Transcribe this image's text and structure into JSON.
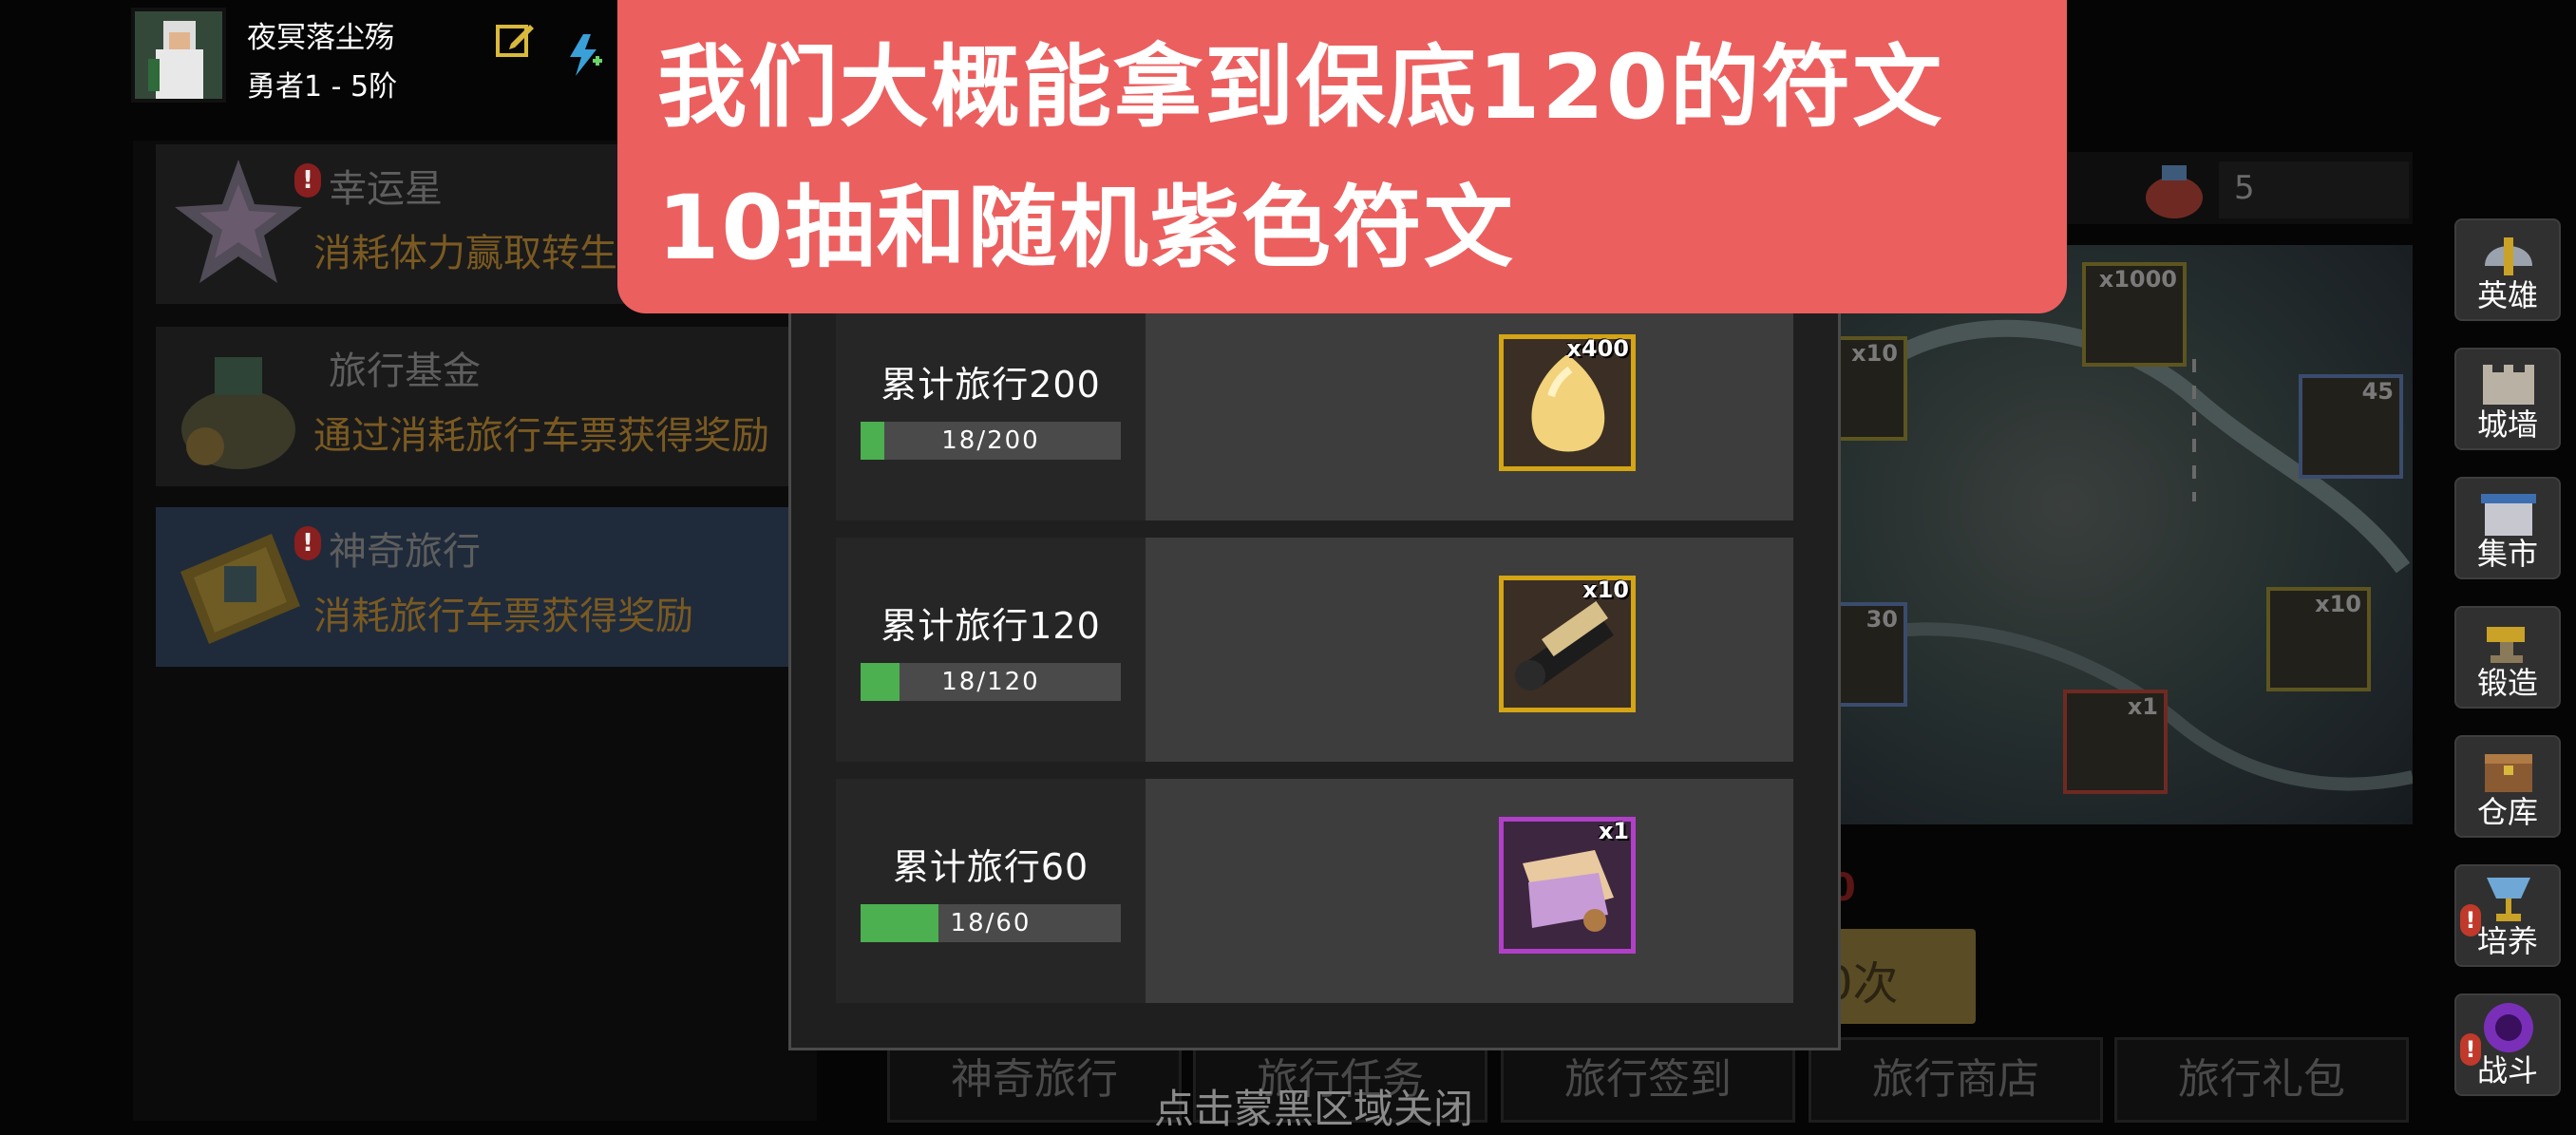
{
  "player": {
    "name": "夜冥落尘殇",
    "rank": "勇者1 - 5阶",
    "edit_icon": "edit-icon",
    "boost_icon": "lightning-plus-icon"
  },
  "events": [
    {
      "title": "幸运星",
      "desc": "消耗体力赢取转生",
      "icon": "star-crystal-icon",
      "alert": "!"
    },
    {
      "title": "旅行基金",
      "desc": "通过消耗旅行车票获得奖励",
      "icon": "money-bag-icon",
      "alert": ""
    },
    {
      "title": "神奇旅行",
      "desc": "消耗旅行车票获得奖励",
      "icon": "ticket-icon",
      "alert": "!"
    }
  ],
  "map": {
    "ticket_count": "5",
    "items": [
      {
        "count": "x1000",
        "icon": "bone-icon"
      },
      {
        "count": "x10",
        "icon": "hammer-icon"
      },
      {
        "count": "45",
        "icon": "money-bag-icon"
      },
      {
        "count": "30",
        "icon": "money-bag-icon"
      },
      {
        "count": "x10",
        "icon": "crystal-egg-icon"
      },
      {
        "count": "x1",
        "icon": "blue-gem-icon"
      }
    ],
    "draw_label": "0次",
    "red_mark": "0"
  },
  "modal": {
    "rewards": [
      {
        "title": "累计旅行200",
        "current": 18,
        "target": 200,
        "progress_text": "18/200",
        "qty": "x400",
        "icon": "golden-egg-icon",
        "frame": "gold",
        "progress": 0.09
      },
      {
        "title": "累计旅行120",
        "current": 18,
        "target": 120,
        "progress_text": "18/120",
        "qty": "x10",
        "icon": "scroll-icon",
        "frame": "gold",
        "progress": 0.15
      },
      {
        "title": "累计旅行60",
        "current": 18,
        "target": 60,
        "progress_text": "18/60",
        "qty": "x1",
        "icon": "purple-rune-icon",
        "frame": "purple",
        "progress": 0.3
      }
    ],
    "close_hint": "点击蒙黑区域关闭"
  },
  "bottom_tabs": [
    "神奇旅行",
    "旅行任务",
    "旅行签到",
    "旅行商店",
    "旅行礼包"
  ],
  "side_nav": [
    {
      "label": "英雄",
      "icon": "helmet-icon",
      "alert": ""
    },
    {
      "label": "城墙",
      "icon": "castle-icon",
      "alert": ""
    },
    {
      "label": "集市",
      "icon": "market-icon",
      "alert": ""
    },
    {
      "label": "锻造",
      "icon": "anvil-icon",
      "alert": ""
    },
    {
      "label": "仓库",
      "icon": "chest-icon",
      "alert": ""
    },
    {
      "label": "培养",
      "icon": "goblet-icon",
      "alert": "!"
    },
    {
      "label": "战斗",
      "icon": "portal-icon",
      "alert": "!"
    }
  ],
  "caption": {
    "line1": "我们大概能拿到保底120的符文",
    "line2": "10抽和随机紫色符文"
  },
  "colors": {
    "caption_bg": "#ec5f5f",
    "progress_fill": "#4caf50",
    "gold_frame": "#d4a514",
    "purple_frame": "#b040c8"
  }
}
